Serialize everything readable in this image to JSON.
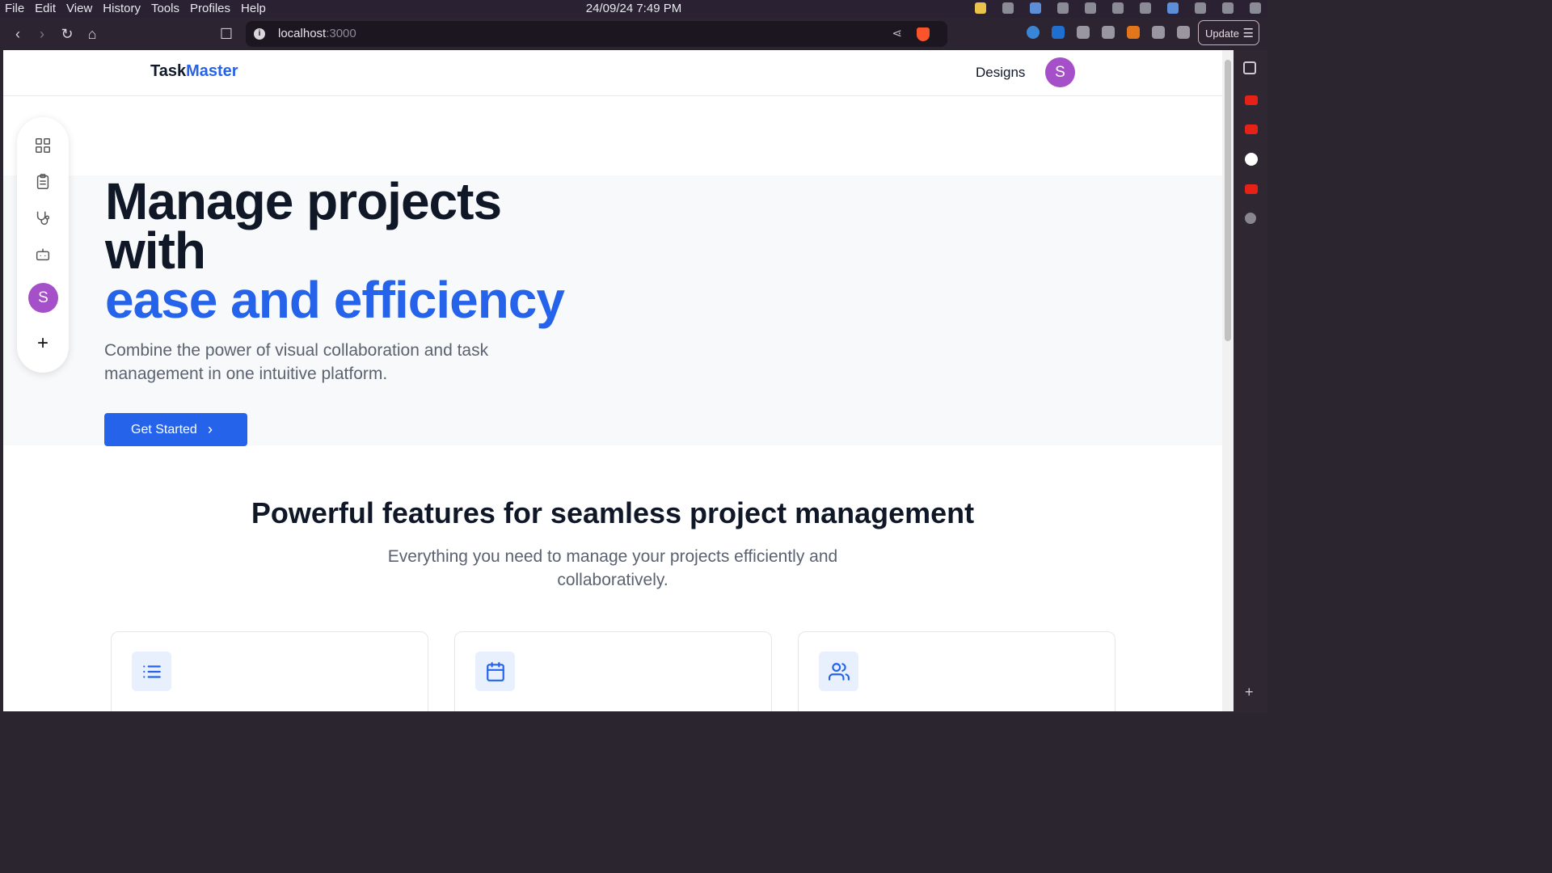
{
  "os": {
    "menus": [
      "File",
      "Edit",
      "View",
      "History",
      "Tools",
      "Profiles",
      "Help"
    ],
    "clock": "24/09/24 7:49 PM"
  },
  "browser": {
    "url_host": "localhost",
    "url_port": ":3000",
    "update_label": "Update",
    "update_menu_glyph": "☰"
  },
  "app": {
    "logo_part1": "Task",
    "logo_part2": "Master",
    "nav_designs": "Designs",
    "avatar_initial": "S",
    "accent_color": "#2563eb",
    "avatar_color": "#a54fc8"
  },
  "hero": {
    "title_line1": "Manage projects",
    "title_line2": "with",
    "title_line3": "ease and efficiency",
    "lead": "Combine the power of visual collaboration and task management in one intuitive platform.",
    "cta_label": "Get Started",
    "cta_glyph": "›"
  },
  "features": {
    "heading": "Powerful features for seamless project management",
    "subheading": "Everything you need to manage your projects efficiently and collaboratively.",
    "cards": [
      {
        "icon": "list-icon"
      },
      {
        "icon": "calendar-icon"
      },
      {
        "icon": "users-icon"
      }
    ]
  },
  "dock": {
    "avatar_initial": "S",
    "add_glyph": "+",
    "icons": [
      "grid-icon",
      "clipboard-icon",
      "stethoscope-icon",
      "bot-icon"
    ]
  }
}
